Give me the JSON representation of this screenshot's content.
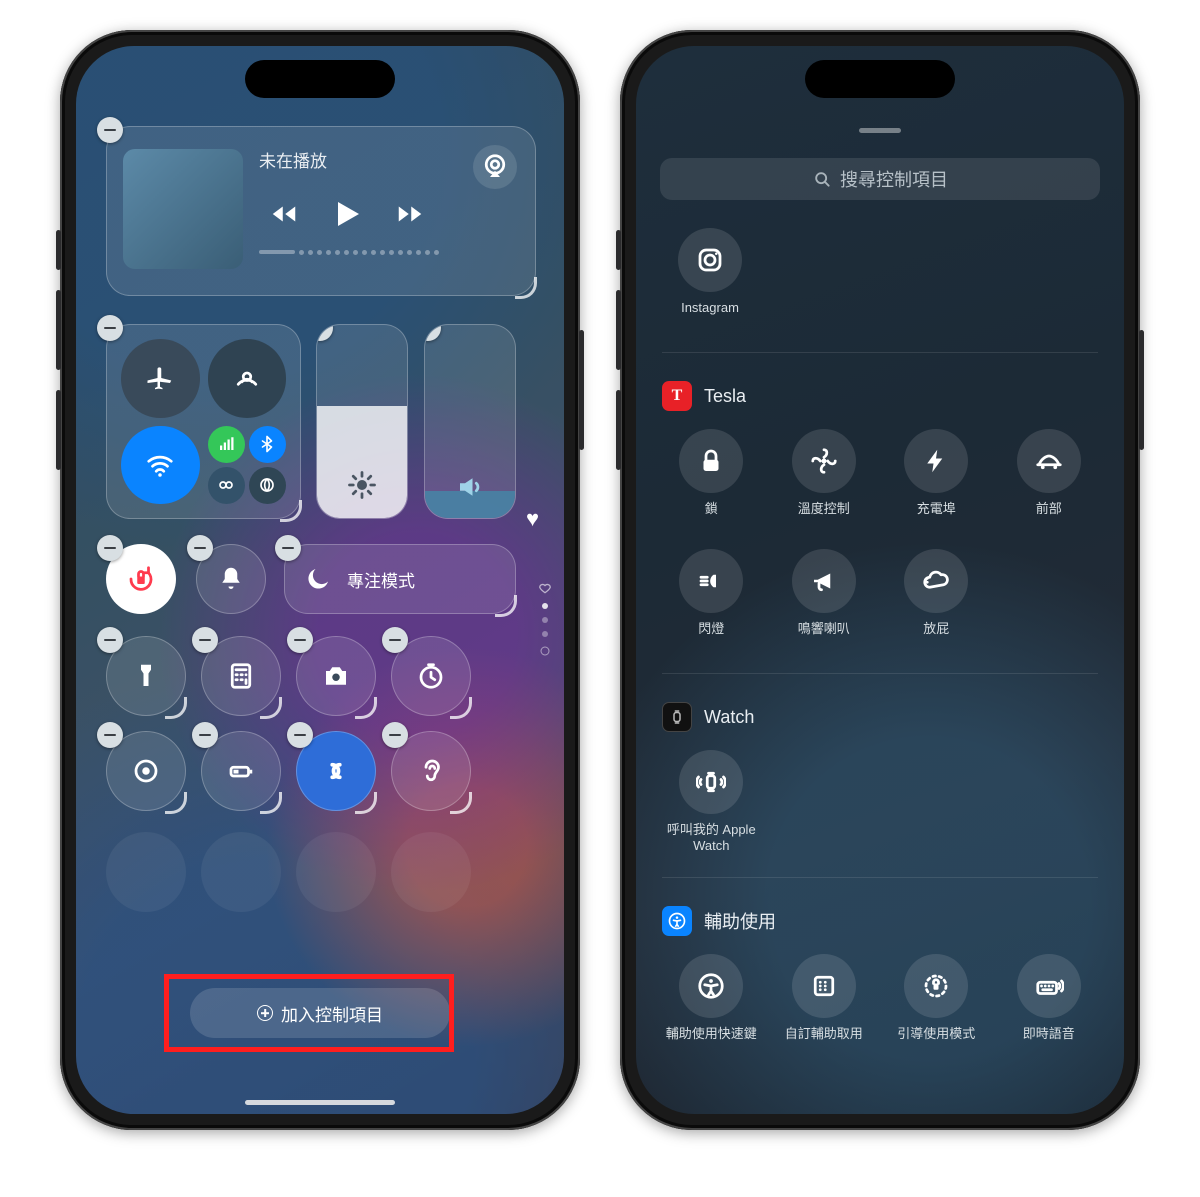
{
  "left": {
    "music": {
      "now_playing": "未在播放"
    },
    "focus": {
      "label": "專注模式"
    },
    "add_button": "加入控制項目"
  },
  "right": {
    "search_placeholder": "搜尋控制項目",
    "sections": {
      "instagram": {
        "title": "Instagram",
        "items": [
          {
            "label": "Instagram"
          }
        ]
      },
      "tesla": {
        "title": "Tesla",
        "items": [
          {
            "label": "鎖"
          },
          {
            "label": "溫度控制"
          },
          {
            "label": "充電埠"
          },
          {
            "label": "前部"
          },
          {
            "label": "閃燈"
          },
          {
            "label": "鳴響喇叭"
          },
          {
            "label": "放屁"
          }
        ]
      },
      "watch": {
        "title": "Watch",
        "items": [
          {
            "label": "呼叫我的 Apple Watch"
          }
        ]
      },
      "accessibility": {
        "title": "輔助使用",
        "items": [
          {
            "label": "輔助使用快速鍵"
          },
          {
            "label": "自訂輔助取用"
          },
          {
            "label": "引導使用模式"
          },
          {
            "label": "即時語音"
          }
        ]
      }
    }
  }
}
